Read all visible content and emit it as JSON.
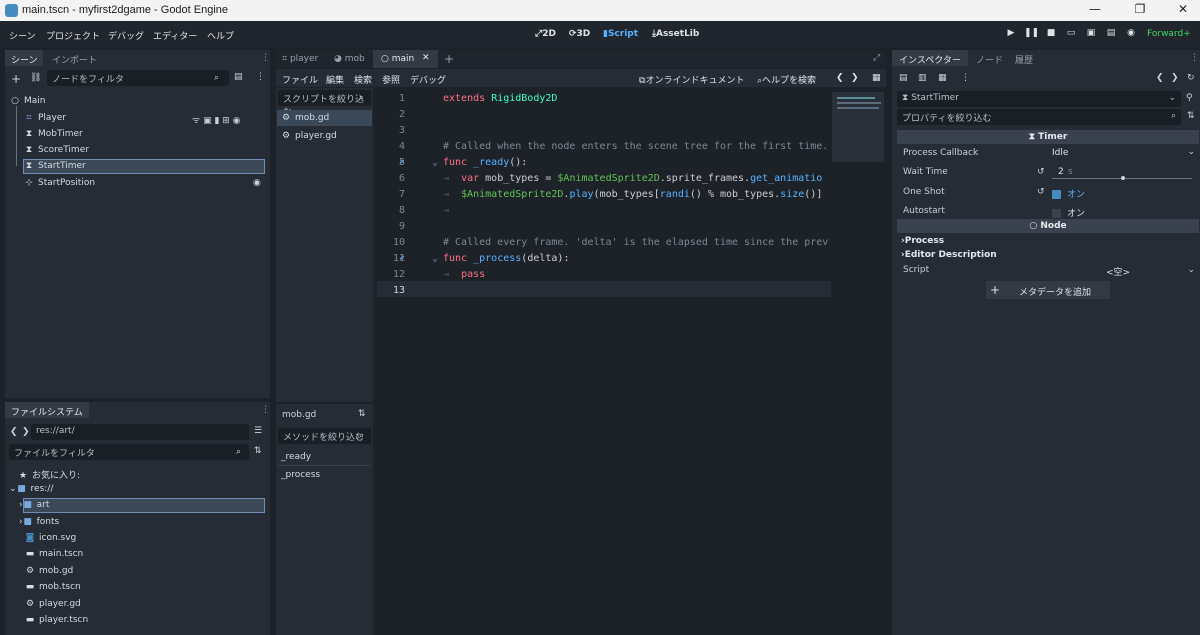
{
  "window": {
    "title": "main.tscn - myfirst2dgame - Godot Engine",
    "minimize": "—",
    "restore": "❐",
    "close": "✕"
  },
  "menu": {
    "items": [
      "シーン",
      "プロジェクト",
      "デバッグ",
      "エディター",
      "ヘルプ"
    ],
    "workspaces": [
      "2D",
      "3D",
      "Script",
      "AssetLib"
    ],
    "active_workspace": "Script",
    "renderer": "Forward+"
  },
  "scene_dock": {
    "tabs": [
      "シーン",
      "インポート"
    ],
    "filter_placeholder": "ノードをフィルタ",
    "nodes": [
      {
        "name": "Main",
        "icon": "node2d-icon"
      },
      {
        "name": "Player",
        "icon": "player-scene-icon"
      },
      {
        "name": "MobTimer",
        "icon": "timer-icon"
      },
      {
        "name": "ScoreTimer",
        "icon": "timer-icon"
      },
      {
        "name": "StartTimer",
        "icon": "timer-icon"
      },
      {
        "name": "StartPosition",
        "icon": "marker2d-icon"
      }
    ],
    "selected": "StartTimer"
  },
  "filesystem_dock": {
    "tab": "ファイルシステム",
    "path": "res://art/",
    "filter_placeholder": "ファイルをフィルタ",
    "items": [
      {
        "name": "お気に入り:",
        "icon": "star-icon"
      },
      {
        "name": "res://",
        "icon": "folder-icon"
      },
      {
        "name": "art",
        "icon": "folder-icon"
      },
      {
        "name": "fonts",
        "icon": "folder-icon"
      },
      {
        "name": "icon.svg",
        "icon": "svg-icon"
      },
      {
        "name": "main.tscn",
        "icon": "scene-icon"
      },
      {
        "name": "mob.gd",
        "icon": "gear-icon"
      },
      {
        "name": "mob.tscn",
        "icon": "scene-icon"
      },
      {
        "name": "player.gd",
        "icon": "gear-icon"
      },
      {
        "name": "player.tscn",
        "icon": "scene-icon"
      }
    ],
    "selected": "art"
  },
  "editor_tabs": {
    "tabs": [
      "player",
      "mob",
      "main"
    ],
    "active": "main",
    "add": "+"
  },
  "script_menu": {
    "items": [
      "ファイル",
      "編集",
      "検索",
      "参照",
      "デバッグ"
    ],
    "online_docs": "オンラインドキュメント",
    "help_search": "ヘルプを検索"
  },
  "script_list": {
    "filter_placeholder": "スクリプトを絞り込む",
    "scripts": [
      "mob.gd",
      "player.gd"
    ],
    "selected": "mob.gd",
    "current_script": "mob.gd",
    "method_filter_placeholder": "メソッドを絞り込む",
    "methods": [
      "_ready",
      "_process"
    ]
  },
  "code": {
    "line_numbers": [
      "1",
      "2",
      "3",
      "4",
      "5",
      "6",
      "7",
      "8",
      "9",
      "10",
      "11",
      "12",
      "13"
    ],
    "current_line": 13
  },
  "inspector": {
    "tabs": [
      "インスペクター",
      "ノード",
      "履歴"
    ],
    "object_name": "StartTimer",
    "filter_placeholder": "プロパティを絞り込む",
    "section_timer": "Timer",
    "properties": {
      "process_callback_label": "Process Callback",
      "process_callback_value": "Idle",
      "wait_time_label": "Wait Time",
      "wait_time_value": "2",
      "wait_time_unit": "s",
      "one_shot_label": "One Shot",
      "one_shot_value": "オン",
      "autostart_label": "Autostart",
      "autostart_value": "オン"
    },
    "section_node": "Node",
    "groups": [
      "Process",
      "Editor Description"
    ],
    "script_label": "Script",
    "script_value": "<空>",
    "add_metadata": "メタデータを追加"
  },
  "colors": {
    "accent": "#478cbf",
    "keyword": "#ff7085",
    "function": "#57b3ff",
    "comment": "#7d8794",
    "node_path": "#63c259",
    "renderer": "#45d660"
  }
}
